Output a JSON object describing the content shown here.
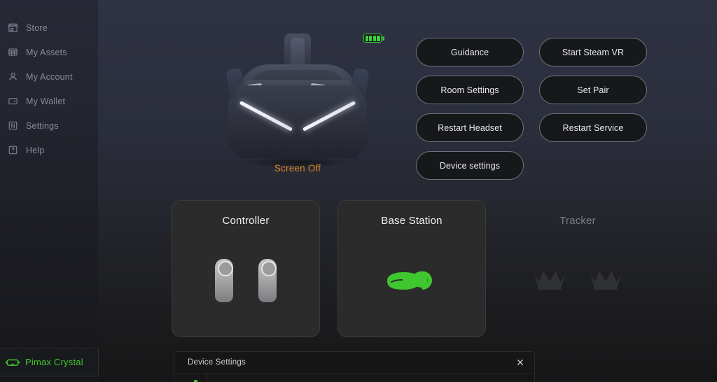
{
  "app": {
    "background_top": "#2f3242",
    "background_bottom": "#161617",
    "accent_green": "#3ec72e",
    "accent_orange": "#d4882a"
  },
  "sidebar": {
    "items": [
      {
        "label": "Store",
        "icon": "store-icon"
      },
      {
        "label": "My Assets",
        "icon": "grid-icon"
      },
      {
        "label": "My Account",
        "icon": "person-icon"
      },
      {
        "label": "My Wallet",
        "icon": "wallet-icon"
      },
      {
        "label": "Settings",
        "icon": "sliders-icon"
      },
      {
        "label": "Help",
        "icon": "question-icon"
      }
    ],
    "device_chip": {
      "label": "Pimax Crystal",
      "icon": "headset-icon",
      "color": "#3ec72e"
    }
  },
  "headset": {
    "status_label": "Screen Off",
    "status_color": "#d4882a",
    "battery": {
      "icon": "battery-icon",
      "bars_filled": 4,
      "bars_total": 4,
      "color": "#3ed13f"
    }
  },
  "actions": {
    "buttons": [
      {
        "label": "Guidance"
      },
      {
        "label": "Start Steam VR"
      },
      {
        "label": "Room Settings"
      },
      {
        "label": "Set Pair"
      },
      {
        "label": "Restart Headset"
      },
      {
        "label": "Restart Service"
      },
      {
        "label": "Device settings"
      }
    ]
  },
  "devices": {
    "cards": [
      {
        "title": "Controller",
        "art": "controller-pair",
        "enabled": true
      },
      {
        "title": "Base Station",
        "art": "base-station",
        "enabled": true
      },
      {
        "title": "Tracker",
        "art": "tracker-pair",
        "enabled": false
      }
    ]
  },
  "modal": {
    "title": "Device Settings",
    "close_icon": "close-icon"
  }
}
